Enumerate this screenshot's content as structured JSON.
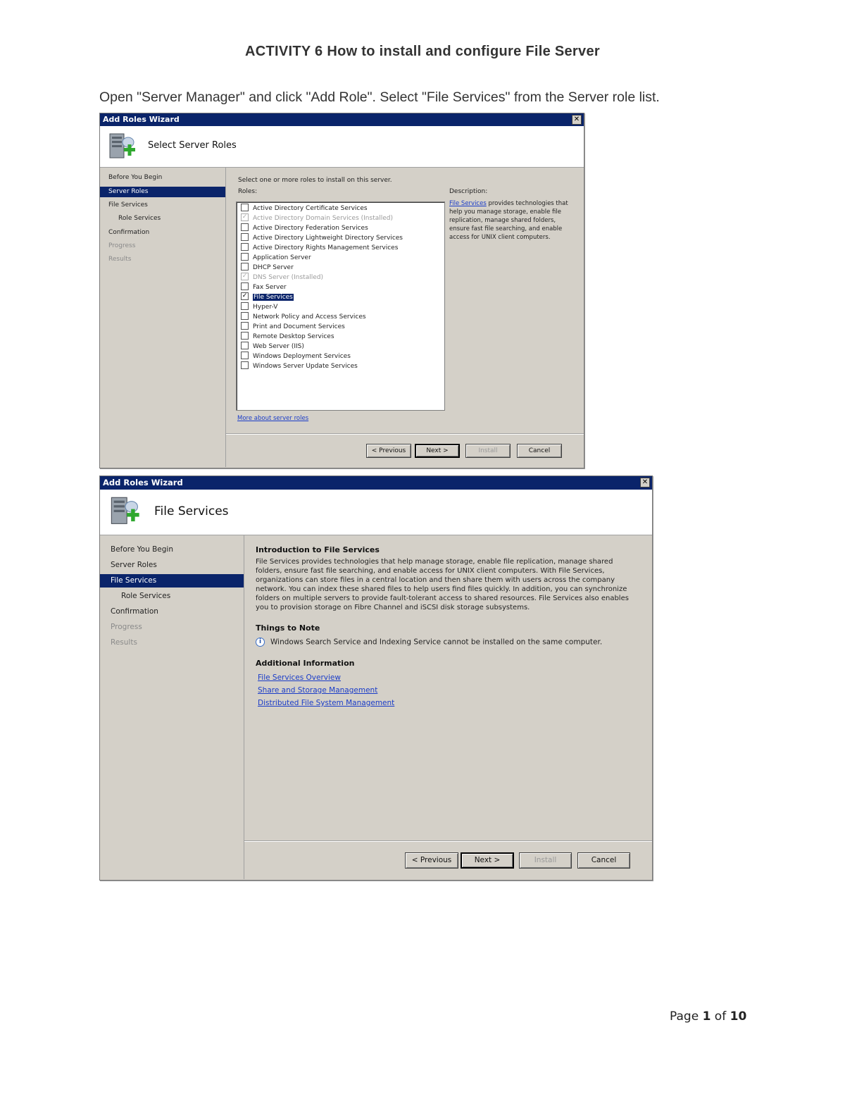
{
  "doc": {
    "title": "ACTIVITY 6 How to install and configure File Server",
    "instruction": "Open \"Server Manager\" and click \"Add Role\". Select \"File Services\" from the Server role list.",
    "page_prefix": "Page ",
    "page_current": "1",
    "page_of": " of ",
    "page_total": "10"
  },
  "wizard1": {
    "window_title": "Add Roles Wizard",
    "close_glyph": "✕",
    "header_title": "Select Server Roles",
    "nav": [
      {
        "label": "Before You Begin",
        "state": "normal"
      },
      {
        "label": "Server Roles",
        "state": "active"
      },
      {
        "label": "File Services",
        "state": "normal"
      },
      {
        "label": "Role Services",
        "state": "sub"
      },
      {
        "label": "Confirmation",
        "state": "normal"
      },
      {
        "label": "Progress",
        "state": "disabled"
      },
      {
        "label": "Results",
        "state": "disabled"
      }
    ],
    "prompt": "Select one or more roles to install on this server.",
    "roles_label": "Roles:",
    "roles": [
      {
        "label": "Active Directory Certificate Services",
        "checked": false,
        "installed": false
      },
      {
        "label": "Active Directory Domain Services  (Installed)",
        "checked": true,
        "installed": true
      },
      {
        "label": "Active Directory Federation Services",
        "checked": false,
        "installed": false
      },
      {
        "label": "Active Directory Lightweight Directory Services",
        "checked": false,
        "installed": false
      },
      {
        "label": "Active Directory Rights Management Services",
        "checked": false,
        "installed": false
      },
      {
        "label": "Application Server",
        "checked": false,
        "installed": false
      },
      {
        "label": "DHCP Server",
        "checked": false,
        "installed": false
      },
      {
        "label": "DNS Server  (Installed)",
        "checked": true,
        "installed": true
      },
      {
        "label": "Fax Server",
        "checked": false,
        "installed": false
      },
      {
        "label": "File Services",
        "checked": true,
        "installed": false,
        "selected": true
      },
      {
        "label": "Hyper-V",
        "checked": false,
        "installed": false
      },
      {
        "label": "Network Policy and Access Services",
        "checked": false,
        "installed": false
      },
      {
        "label": "Print and Document Services",
        "checked": false,
        "installed": false
      },
      {
        "label": "Remote Desktop Services",
        "checked": false,
        "installed": false
      },
      {
        "label": "Web Server (IIS)",
        "checked": false,
        "installed": false
      },
      {
        "label": "Windows Deployment Services",
        "checked": false,
        "installed": false
      },
      {
        "label": "Windows Server Update Services",
        "checked": false,
        "installed": false
      }
    ],
    "description_label": "Description:",
    "description_link": "File Services",
    "description_text": " provides technologies that help you manage storage, enable file replication, manage shared folders, ensure fast file searching, and enable access for UNIX client computers.",
    "more_link": "More about server roles",
    "buttons": {
      "previous": "< Previous",
      "next": "Next >",
      "install": "Install",
      "cancel": "Cancel"
    }
  },
  "wizard2": {
    "window_title": "Add Roles Wizard",
    "close_glyph": "✕",
    "header_title": "File Services",
    "nav": [
      {
        "label": "Before You Begin",
        "state": "normal"
      },
      {
        "label": "Server Roles",
        "state": "normal"
      },
      {
        "label": "File Services",
        "state": "active"
      },
      {
        "label": "Role Services",
        "state": "sub"
      },
      {
        "label": "Confirmation",
        "state": "normal"
      },
      {
        "label": "Progress",
        "state": "disabled"
      },
      {
        "label": "Results",
        "state": "disabled"
      }
    ],
    "intro_heading": "Introduction to File Services",
    "intro_text": "File Services provides technologies that help manage storage, enable file replication, manage shared folders, ensure fast file searching, and enable access for UNIX client computers. With File Services, organizations can store files in a central location and then share them with users across the company network. You can index these shared files to help users find files quickly. In addition, you can synchronize folders on multiple servers to provide fault-tolerant access to shared resources. File Services also enables you to provision storage on Fibre Channel and iSCSI disk storage subsystems.",
    "things_heading": "Things to Note",
    "note_icon": "i",
    "note_text": "Windows Search Service and Indexing Service cannot be installed on the same computer.",
    "additional_heading": "Additional Information",
    "links": [
      "File Services Overview",
      "Share and Storage Management",
      "Distributed File System Management"
    ],
    "buttons": {
      "previous": "< Previous",
      "next": "Next >",
      "install": "Install",
      "cancel": "Cancel"
    }
  }
}
